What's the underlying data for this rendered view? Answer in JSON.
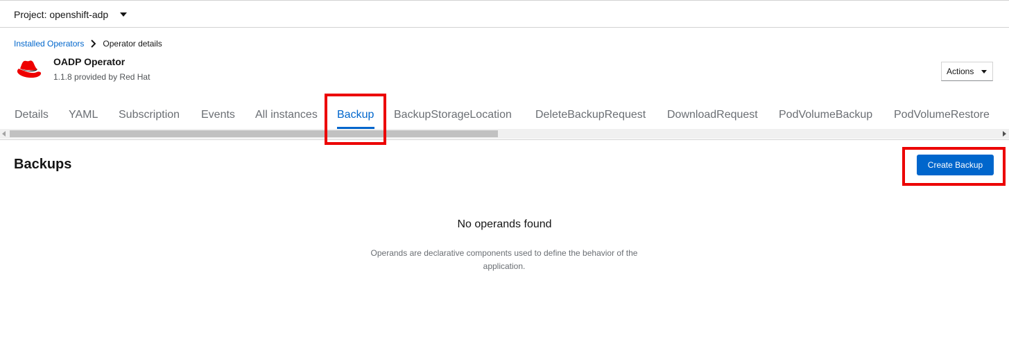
{
  "project": {
    "label": "Project: openshift-adp"
  },
  "breadcrumb": {
    "parent": "Installed Operators",
    "current": "Operator details"
  },
  "operator": {
    "name": "OADP Operator",
    "provider": "1.1.8 provided by Red Hat",
    "logo_icon": "redhat-fedora-icon",
    "logo_color": "#ee0000"
  },
  "actions": {
    "label": "Actions"
  },
  "tabs": [
    {
      "label": "Details"
    },
    {
      "label": "YAML"
    },
    {
      "label": "Subscription"
    },
    {
      "label": "Events"
    },
    {
      "label": "All instances"
    },
    {
      "label": "Backup",
      "active": true
    },
    {
      "label": "BackupStorageLocation"
    },
    {
      "label": "DeleteBackupRequest"
    },
    {
      "label": "DownloadRequest"
    },
    {
      "label": "PodVolumeBackup"
    },
    {
      "label": "PodVolumeRestore"
    }
  ],
  "section": {
    "title": "Backups",
    "create_label": "Create Backup"
  },
  "empty_state": {
    "title": "No operands found",
    "body": "Operands are declarative components used to define the behavior of the application."
  },
  "colors": {
    "accent": "#0066cc",
    "highlight": "#ec0000",
    "brand": "#ee0000"
  }
}
